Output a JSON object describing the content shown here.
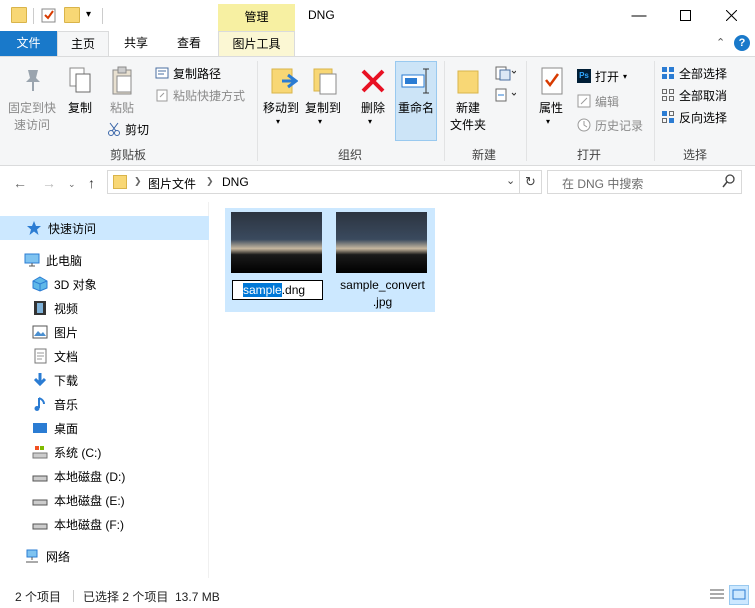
{
  "window": {
    "title": "DNG",
    "context_tab": "管理",
    "colors": {
      "file_tab": "#1979ca",
      "context": "#f7f0a2",
      "selection": "#cce8ff"
    }
  },
  "tabs": [
    "文件",
    "主页",
    "共享",
    "查看",
    "图片工具"
  ],
  "ribbon": {
    "clipboard": {
      "label": "剪贴板",
      "pin": "固定到快速访问",
      "copy": "复制",
      "paste": "粘贴",
      "copy_path": "复制路径",
      "paste_shortcut": "粘贴快捷方式",
      "cut": "剪切"
    },
    "organize": {
      "label": "组织",
      "move_to": "移动到",
      "copy_to": "复制到",
      "delete": "删除",
      "rename": "重命名"
    },
    "new": {
      "label": "新建",
      "new_folder": "新建\n文件夹"
    },
    "open": {
      "label": "打开",
      "properties": "属性",
      "open": "打开",
      "edit": "编辑",
      "history": "历史记录"
    },
    "select": {
      "label": "选择",
      "select_all": "全部选择",
      "select_none": "全部取消",
      "invert": "反向选择"
    }
  },
  "address": {
    "path": [
      "图片文件",
      "DNG"
    ],
    "search_placeholder": "在 DNG 中搜索"
  },
  "nav": {
    "quick_access": "快速访问",
    "this_pc": "此电脑",
    "items": [
      "3D 对象",
      "视频",
      "图片",
      "文档",
      "下载",
      "音乐",
      "桌面",
      "系统 (C:)",
      "本地磁盘 (D:)",
      "本地磁盘 (E:)",
      "本地磁盘 (F:)"
    ],
    "network": "网络"
  },
  "files": [
    {
      "name_selected": "sample",
      "name_rest": ".dng",
      "editing": true
    },
    {
      "name": "sample_convert\n.jpg",
      "editing": false
    }
  ],
  "status": {
    "count": "2 个项目",
    "selection": "已选择 2 个项目  13.7 MB"
  }
}
